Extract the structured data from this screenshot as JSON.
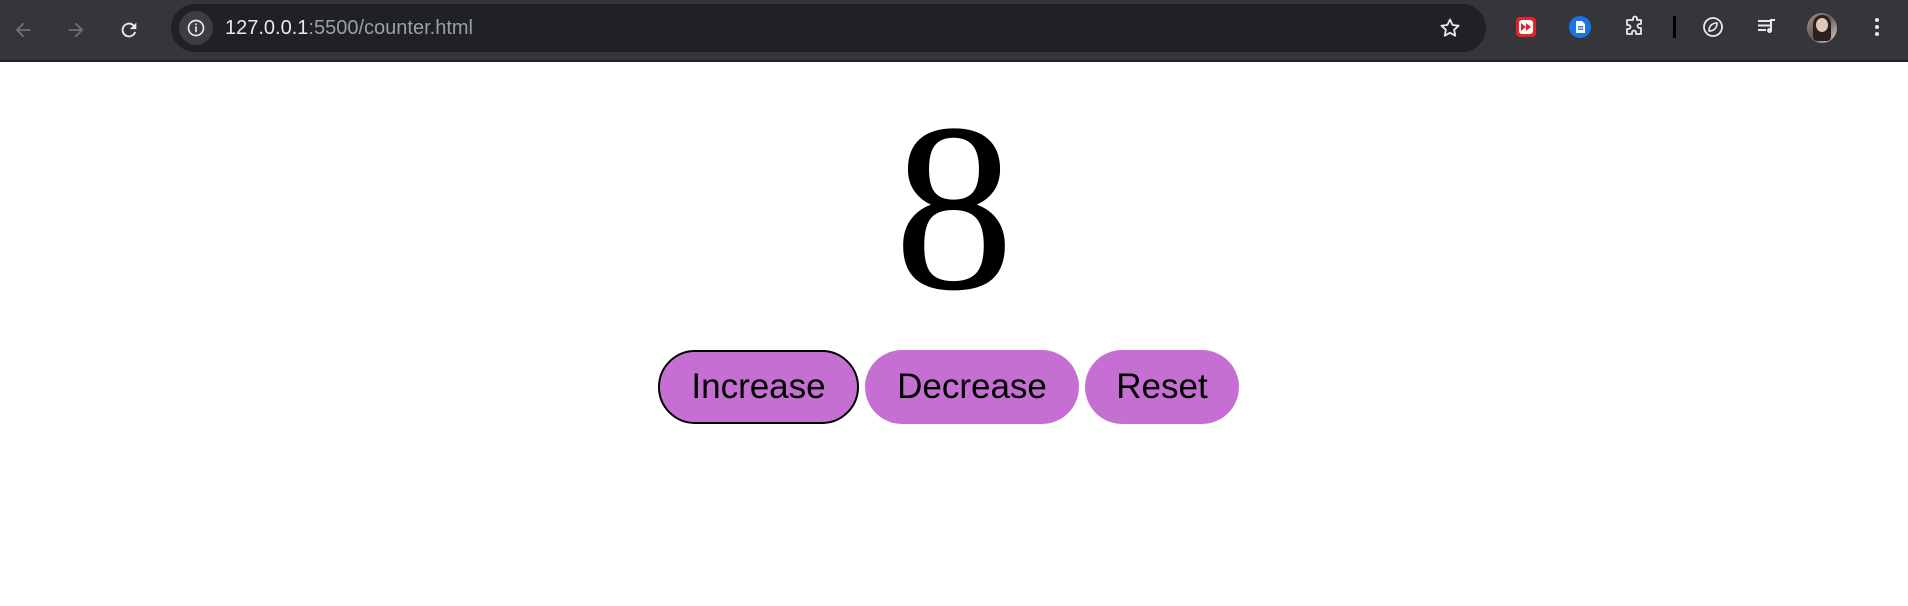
{
  "browser": {
    "url_host": "127.0.0.1",
    "url_rest": ":5500/counter.html",
    "icons": {
      "back": "arrow-left-icon",
      "forward": "arrow-right-icon",
      "reload": "reload-icon",
      "site_info": "info-icon",
      "bookmark": "star-icon",
      "extensions": [
        "media-extension-icon",
        "docs-extension-icon",
        "puzzle-icon",
        "leaf-icon",
        "media-queue-icon"
      ],
      "menu": "kebab-icon"
    }
  },
  "counter": {
    "value": "8"
  },
  "buttons": {
    "increase": "Increase",
    "decrease": "Decrease",
    "reset": "Reset"
  },
  "colors": {
    "button_fill": "#c66fd3",
    "chrome_toolbar": "#35363a",
    "omnibox": "#202124"
  }
}
